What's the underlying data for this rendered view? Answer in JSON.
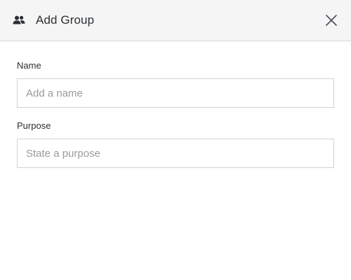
{
  "dialog": {
    "title": "Add Group",
    "title_icon": "group-icon",
    "close_icon": "close-icon"
  },
  "form": {
    "name": {
      "label": "Name",
      "value": "",
      "placeholder": "Add a name"
    },
    "purpose": {
      "label": "Purpose",
      "value": "",
      "placeholder": "State a purpose"
    }
  },
  "colors": {
    "header_bg": "#f5f5f5",
    "border": "#d2d2d2",
    "text": "#2b2f33",
    "placeholder": "#9a9a9a"
  }
}
